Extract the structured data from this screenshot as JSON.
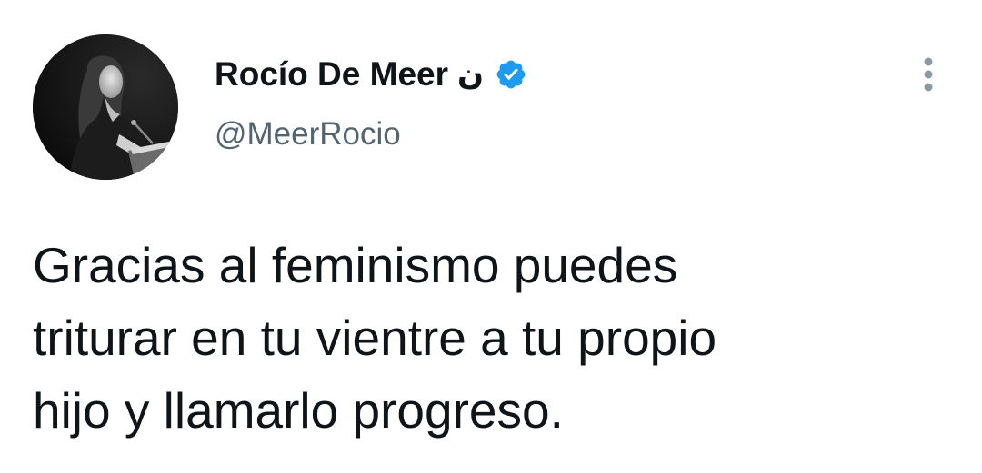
{
  "tweet": {
    "author": {
      "display_name": "Rocío De Meer",
      "name_symbol": "ن",
      "handle": "@MeerRocio",
      "verified": true,
      "avatar_icon": "profile-photo-avatar"
    },
    "text": "Gracias al feminismo puedes\ntriturar en tu vientre a tu propio\nhijo y llamarlo progreso.",
    "more_icon": "more-vertical-icon"
  },
  "colors": {
    "text_primary": "#0f1419",
    "text_secondary": "#536471",
    "verified_blue": "#1d9bf0",
    "background": "#ffffff"
  }
}
